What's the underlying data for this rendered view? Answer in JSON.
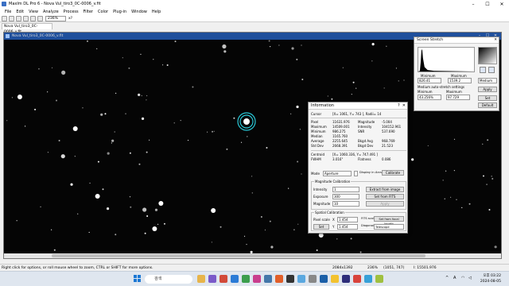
{
  "app": {
    "title": "MaxIm DL Pro 6 - Nova Vul_tiro3_0C-0006_v.fit",
    "min": "–",
    "max": "☐",
    "close": "✕"
  },
  "menu": [
    "File",
    "Edit",
    "View",
    "Analyze",
    "Process",
    "Filter",
    "Color",
    "Plug-in",
    "Window",
    "Help"
  ],
  "toolbar": {
    "zoom": "236%",
    "extra": "x?"
  },
  "tab": {
    "label": "Nova Vul_tiro3_0C-0006_v.fit"
  },
  "image_window": {
    "title": "Nova Vul_tiro3_0C-0006_v.fit"
  },
  "stretch": {
    "title": "Screen Stretch",
    "min_label": "Minimum",
    "max_label": "Maximum",
    "min_value": "826.41",
    "max_value": "1539.2",
    "mode": "Medium",
    "auto_label": "Medium auto-stretch settings",
    "auto_min_label": "Minimum",
    "auto_max_label": "Maximum",
    "auto_min": "43.256%",
    "auto_max": "97.729",
    "apply": "Apply",
    "set": "Set",
    "default": "Default",
    "close": "✕"
  },
  "info": {
    "title": "Information",
    "help": "?",
    "close": "✕",
    "cursor_label": "Cursor",
    "cursor_value": "[X= 1061, Y= 743 ], Radii= 14",
    "rows": [
      {
        "l": "Pixel",
        "v": "11631.976",
        "l2": "Magnitude",
        "v2": "-5.004"
      },
      {
        "l": "Maximum",
        "v": "14509.001",
        "l2": "Intensity",
        "v2": "104152.961"
      },
      {
        "l": "Minimum",
        "v": "986.275",
        "l2": "SNR",
        "v2": "537.690"
      },
      {
        "l": "Median",
        "v": "1165.760",
        "l2": "",
        "v2": ""
      },
      {
        "l": "Average",
        "v": "2255.645",
        "l2": "Bkgd Avg",
        "v2": "968.769"
      },
      {
        "l": "Std Dev",
        "v": "2668.391",
        "l2": "Bkgd Dev",
        "v2": "21.523"
      }
    ],
    "centroid_label": "Centroid",
    "centroid_value": "[X= 1060.336, Y= 747.491 ]",
    "fwhm_label": "FWHM",
    "fwhm_value": "3.016\"",
    "flatness_label": "Flatness",
    "flatness_value": "0.086",
    "mode_label": "Mode",
    "mode_value": "Aperture",
    "display_arcsec": "Display in Arcsec",
    "calibrate": "Calibrate",
    "mag_cal_title": "Magnitude Calibration",
    "intensity_label": "Intensity",
    "intensity_value": "1",
    "exposure_label": "Exposure",
    "exposure_value": "300",
    "magnitude_label": "Magnitude",
    "magnitude_value": "10",
    "extract_image": "Extract from image",
    "extract_fits": "Set from FITS",
    "apply": "Apply",
    "spatial_title": "Spatial Calibration",
    "pixel_scale_label": "Pixel scale",
    "x_label": "X",
    "x_value": "1.454",
    "y_label": "Y",
    "y_value": "1.454",
    "fits_label": "FITS scale",
    "set_btn": "Set",
    "diag_label": "Diagonal from",
    "from_focal": "Set from focal length",
    "from_camera": "Telescope"
  },
  "status": {
    "hint": "Right click for options, or roll mouse wheel to zoom, CTRL or SHIFT for more options.",
    "size": "2084x1392",
    "zoom": "236%",
    "coords": "(1051, 747)",
    "value": "I: 15501.976"
  },
  "taskbar": {
    "search": "검색",
    "time": "오후 03:22",
    "date": "2024-08-05",
    "lang": "A"
  }
}
